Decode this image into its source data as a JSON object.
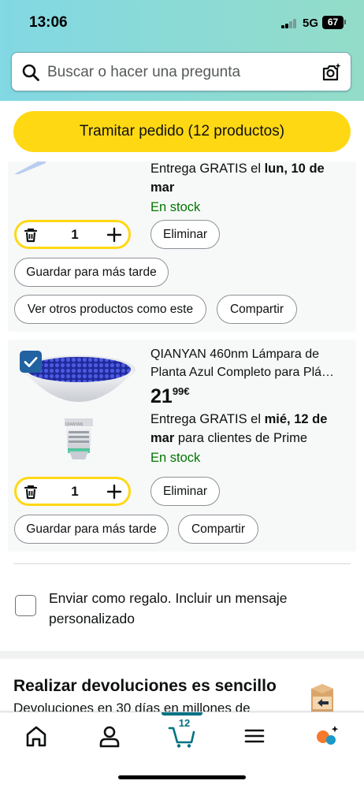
{
  "status_bar": {
    "time": "13:06",
    "network": "5G",
    "battery": "67"
  },
  "search": {
    "placeholder": "Buscar o hacer una pregunta"
  },
  "checkout": {
    "label": "Tramitar pedido (12 productos)"
  },
  "items": [
    {
      "delivery_prefix": "Entrega GRATIS el ",
      "delivery_date_line1": "lun, 10 de",
      "delivery_date_line2": "mar",
      "stock": "En stock",
      "quantity": "1",
      "delete_label": "Eliminar",
      "save_label": "Guardar para más tarde",
      "similar_label": "Ver otros productos como este",
      "share_label": "Compartir"
    },
    {
      "selected": true,
      "title_line1": "QIANYAN 460nm Lámpara de",
      "title_line2": "Planta Azul Completo para Plá…",
      "price_whole": "21",
      "price_fraction": "99",
      "currency": "€",
      "delivery_prefix": "Entrega GRATIS el ",
      "delivery_date_line1": "mié, 12 de",
      "delivery_date_line2": "mar",
      "delivery_suffix": " para clientes de Prime",
      "stock": "En stock",
      "quantity": "1",
      "delete_label": "Eliminar",
      "save_label": "Guardar para más tarde",
      "share_label": "Compartir",
      "image_brand": "QIANYAN"
    }
  ],
  "gift": {
    "label": "Enviar como regalo. Incluir un mensaje personalizado"
  },
  "returns": {
    "title": "Realizar devoluciones es sencillo",
    "subtitle": "Devoluciones en 30 días en millones de"
  },
  "bottom_nav": {
    "items": [
      "home-icon",
      "account-icon",
      "cart-icon",
      "menu-icon",
      "rufus-icon"
    ],
    "cart_count": "12"
  },
  "colors": {
    "header_gradient_start": "#82d8e3",
    "header_gradient_end": "#93dcc8",
    "checkout_yellow": "#ffd814",
    "stock_green": "#007600",
    "checkbox_blue": "#2162a1",
    "nav_teal": "#007185"
  }
}
